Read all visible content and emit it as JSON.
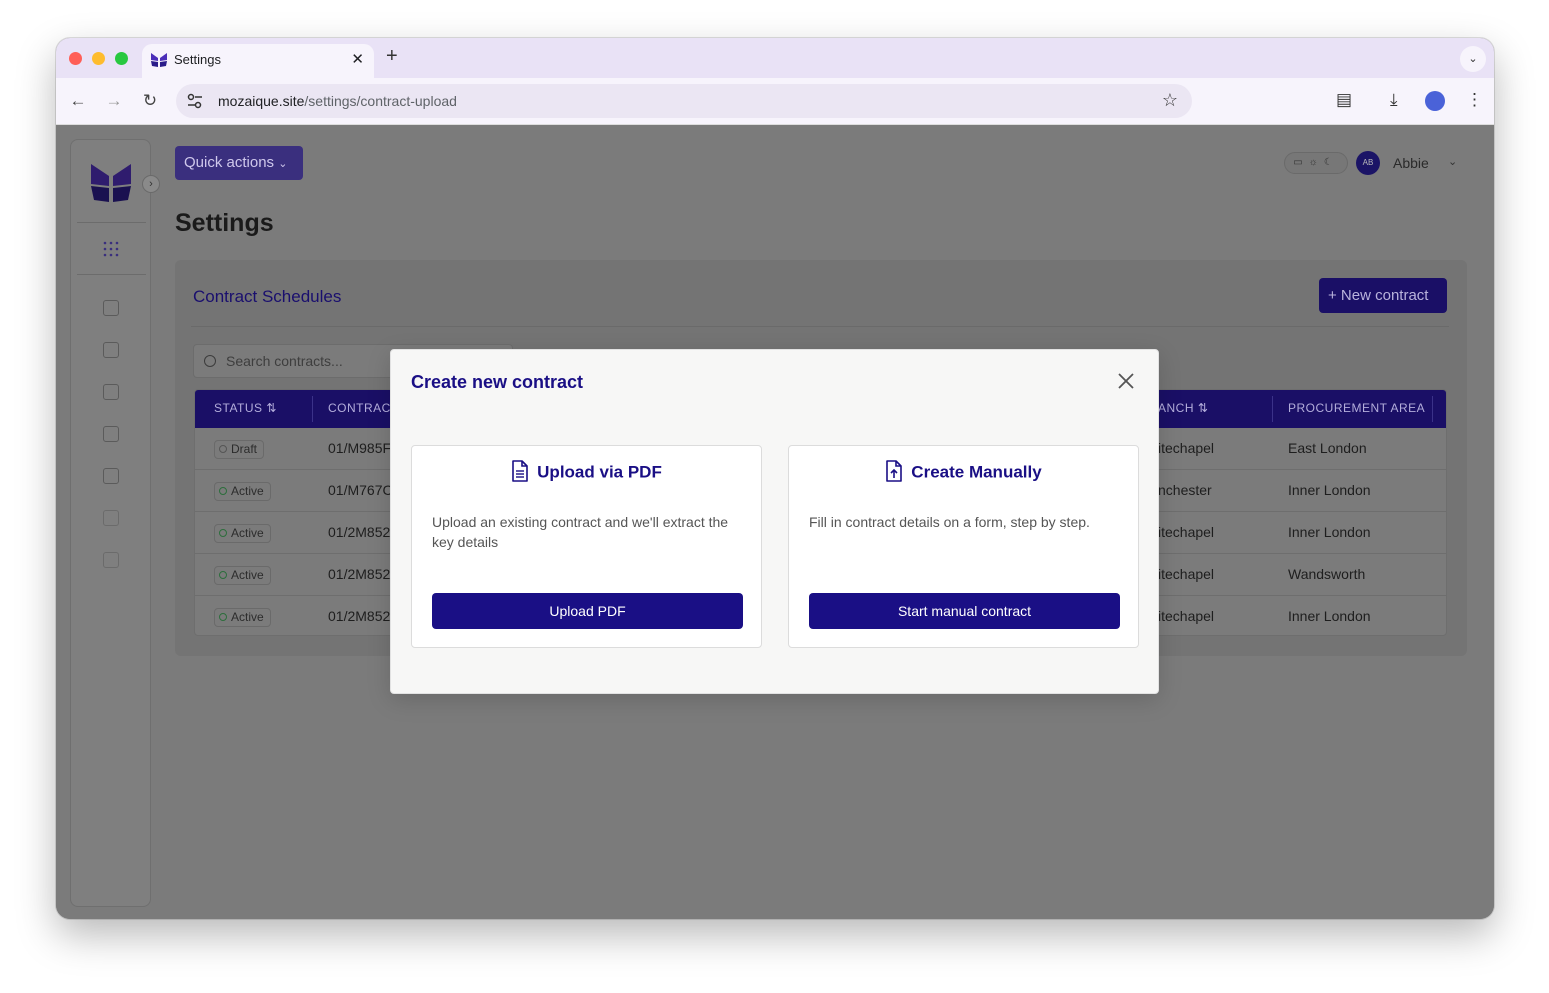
{
  "browser": {
    "tab_title": "Settings",
    "url_domain": "mozaique.site",
    "url_path": "/settings/contract-upload"
  },
  "header": {
    "quick_actions_label": "Quick actions",
    "user_initials": "AB",
    "user_name": "Abbie"
  },
  "page": {
    "title": "Settings"
  },
  "section": {
    "title": "Contract Schedules",
    "new_contract_label": "+ New contract",
    "search_placeholder": "Search contracts..."
  },
  "table": {
    "headers": [
      "STATUS ⇅",
      "CONTRACT",
      "ANCH ⇅",
      "PROCUREMENT AREA"
    ],
    "rows": [
      {
        "status": "Draft",
        "contract": "01/M985F",
        "branch": "itechapel",
        "area": "East London"
      },
      {
        "status": "Active",
        "contract": "01/M767C",
        "branch": "nchester",
        "area": "Inner London"
      },
      {
        "status": "Active",
        "contract": "01/2M852",
        "branch": "itechapel",
        "area": "Inner London"
      },
      {
        "status": "Active",
        "contract": "01/2M852",
        "branch": "itechapel",
        "area": "Wandsworth"
      },
      {
        "status": "Active",
        "contract": "01/2M852",
        "branch": "itechapel",
        "area": "Inner London"
      }
    ]
  },
  "modal": {
    "title": "Create new contract",
    "upload": {
      "heading": "Upload via PDF",
      "description": "Upload an existing contract and we'll extract the key details",
      "button": "Upload PDF"
    },
    "manual": {
      "heading": "Create Manually",
      "description": "Fill in contract details on a form, step by step.",
      "button": "Start manual contract"
    }
  },
  "colors": {
    "brand": "#1a0f85",
    "overlay": "#7b7b7b"
  }
}
